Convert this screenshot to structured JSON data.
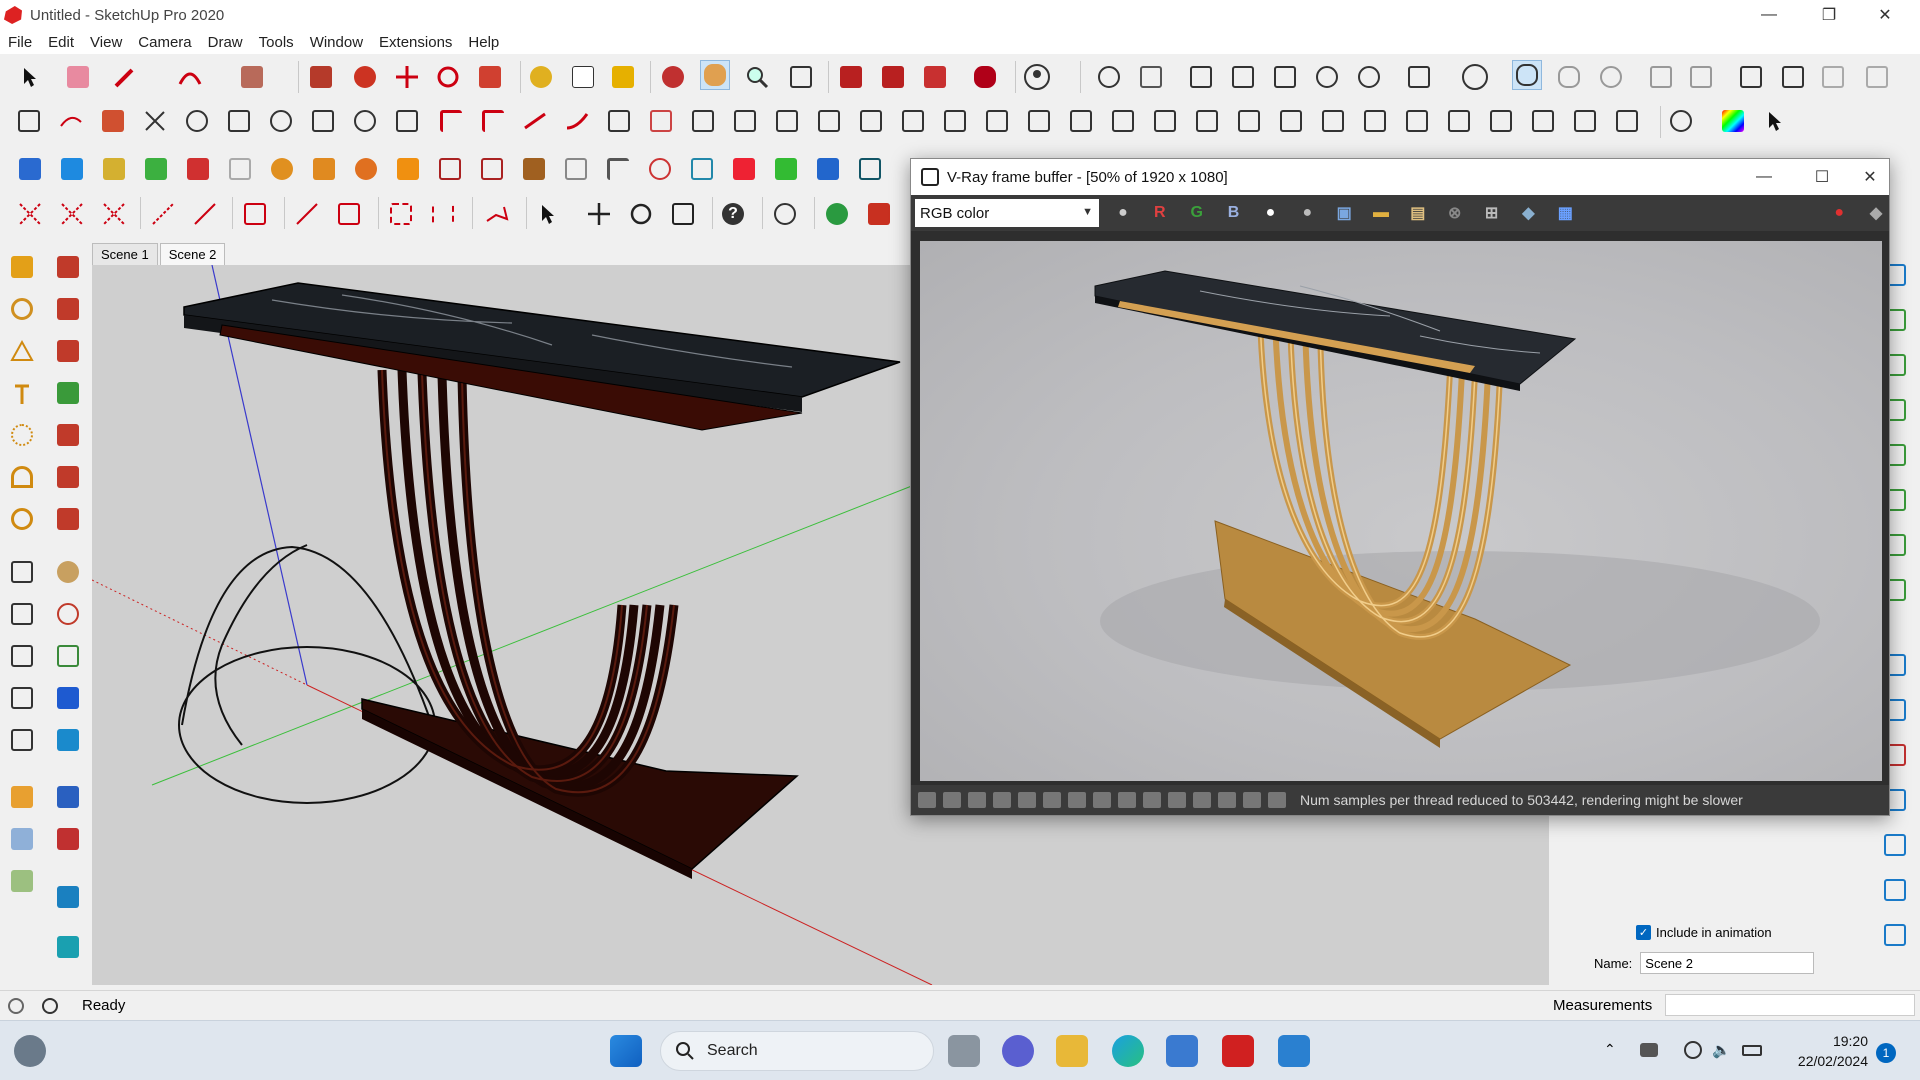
{
  "window": {
    "title": "Untitled - SketchUp Pro 2020"
  },
  "menu": [
    "File",
    "Edit",
    "View",
    "Camera",
    "Draw",
    "Tools",
    "Window",
    "Extensions",
    "Help"
  ],
  "scenes": [
    {
      "label": "Scene 1",
      "active": false
    },
    {
      "label": "Scene 2",
      "active": true
    }
  ],
  "vfb": {
    "title": "V-Ray frame buffer - [50% of 1920 x 1080]",
    "channel": "RGB color",
    "channel_buttons": [
      "R",
      "G",
      "B"
    ],
    "status_message": "Num samples per thread reduced to 503442, rendering might be slower"
  },
  "scene_panel": {
    "include_animation_label": "Include in animation",
    "include_animation_checked": true,
    "name_label": "Name:",
    "name_value": "Scene 2"
  },
  "statusbar": {
    "status": "Ready",
    "measurements_label": "Measurements"
  },
  "taskbar": {
    "search_label": "Search",
    "time": "19:20",
    "date": "22/02/2024",
    "notifications": "1"
  },
  "colors": {
    "accent": "#0067c0",
    "marble": "#1b1f24",
    "wood": "#2a0a05",
    "gold": "#c9974a"
  }
}
